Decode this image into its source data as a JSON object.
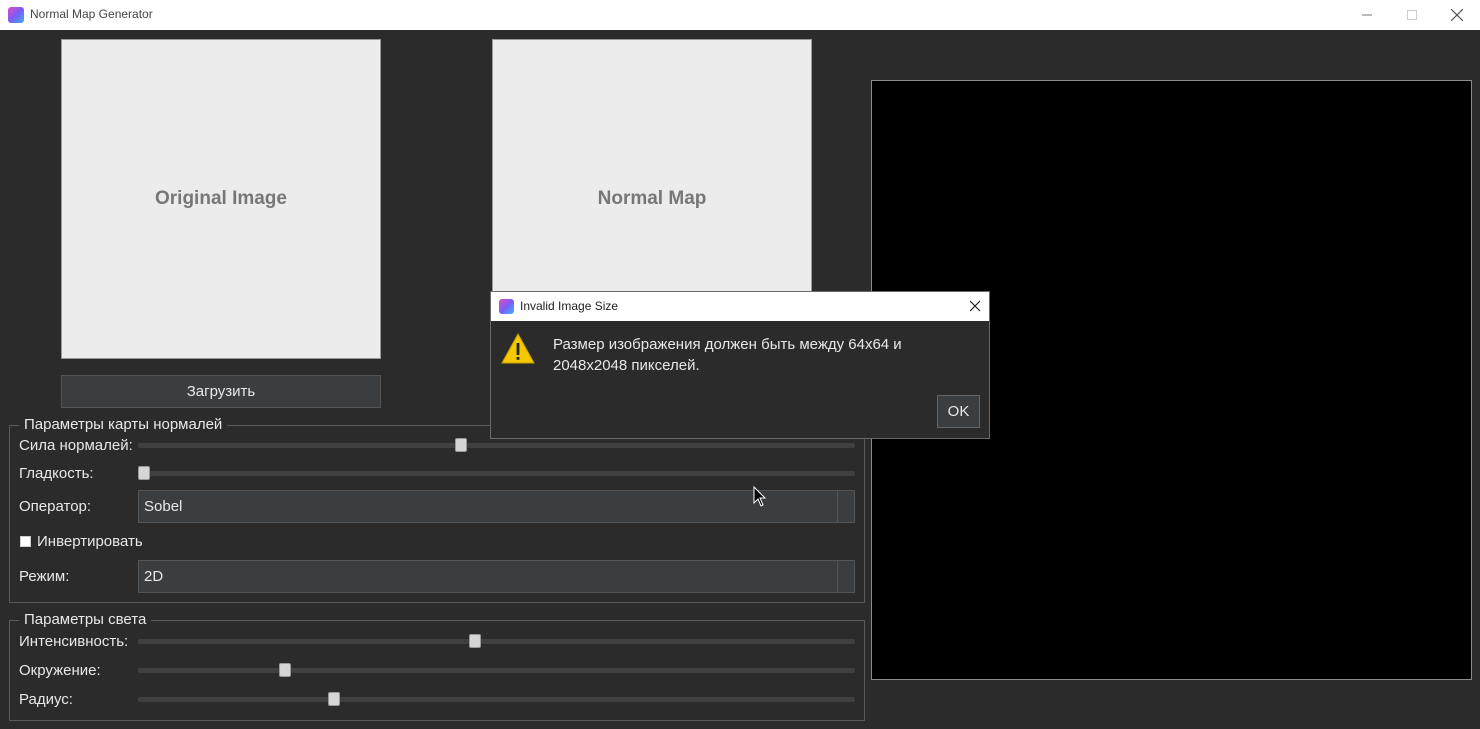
{
  "window": {
    "title": "Normal Map Generator"
  },
  "previews": {
    "original_label": "Original Image",
    "normal_label": "Normal Map"
  },
  "load_button_label": "Загрузить",
  "normal_params": {
    "group_title": "Параметры карты нормалей",
    "strength_label": "Сила нормалей:",
    "strength_value": 0.45,
    "smoothness_label": "Гладкость:",
    "smoothness_value": 0.0,
    "operator_label": "Оператор:",
    "operator_value": "Sobel",
    "invert_label": "Инвертировать",
    "invert_checked": false,
    "mode_label": "Режим:",
    "mode_value": "2D"
  },
  "light_params": {
    "group_title": "Параметры света",
    "intensity_label": "Интенсивность:",
    "intensity_value": 0.47,
    "ambient_label": "Окружение:",
    "ambient_value": 0.2,
    "radius_label": "Радиус:",
    "radius_value": 0.27
  },
  "dialog": {
    "title": "Invalid Image Size",
    "message": "Размер изображения должен быть между 64x64 и 2048x2048 пикселей.",
    "ok_label": "OK",
    "icon": "warning-icon"
  },
  "colors": {
    "background": "#2b2b2b",
    "panel": "#ececec",
    "accent_warning": "#f5c800"
  }
}
